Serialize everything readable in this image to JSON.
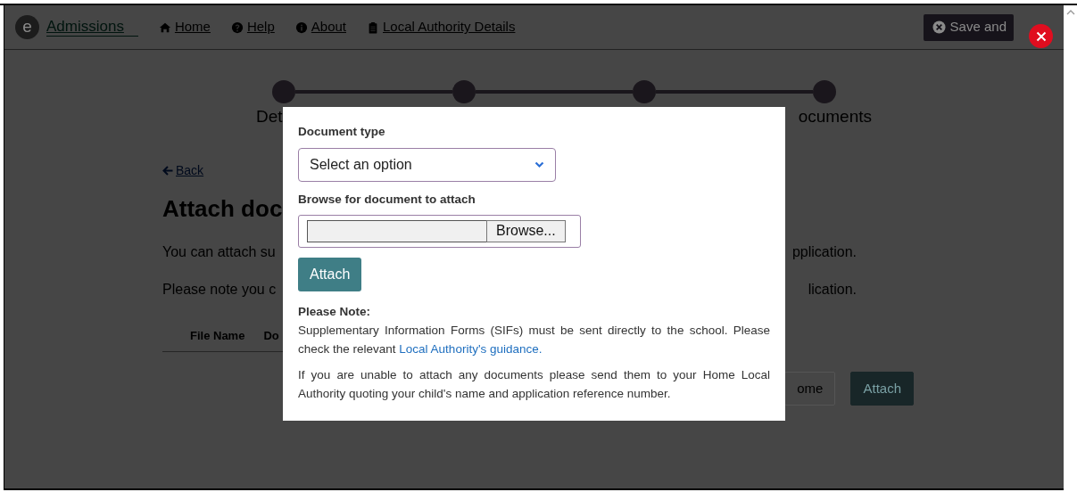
{
  "navbar": {
    "logo_letter": "e",
    "brand": "Admissions",
    "links": [
      {
        "label": "Home"
      },
      {
        "label": "Help"
      },
      {
        "label": "About"
      },
      {
        "label": "Local Authority Details"
      }
    ],
    "save_button": "Save and"
  },
  "steps": [
    {
      "label": "Det",
      "covered": false
    },
    {
      "covered": true
    },
    {
      "covered": true
    },
    {
      "label": "ocuments",
      "covered": false
    }
  ],
  "back_link": "Back",
  "heading": "Attach doc",
  "paragraphs": [
    {
      "left": "You can attach su",
      "right": "pplication."
    },
    {
      "left": "Please note you c",
      "right": "lication."
    }
  ],
  "table": {
    "columns": [
      "File Name",
      "Do"
    ]
  },
  "buttons": [
    {
      "label": "ome",
      "kind": "outline"
    },
    {
      "label": "Attach",
      "kind": "primary"
    }
  ],
  "modal": {
    "document_type_label": "Document type",
    "document_type_select": {
      "value": "Select an option"
    },
    "browse_label": "Browse for document to attach",
    "browse_button": "Browse...",
    "attach_button": "Attach",
    "note_title": "Please Note:",
    "note_text": "Supplementary Information Forms (SIFs) must be sent directly to the school. Please check the relevant ",
    "note_link": "Local Authority's guidance.",
    "note_text_2": "If you are unable to attach any documents please send them to your Home Local Authority quoting your child's name and application reference number."
  }
}
